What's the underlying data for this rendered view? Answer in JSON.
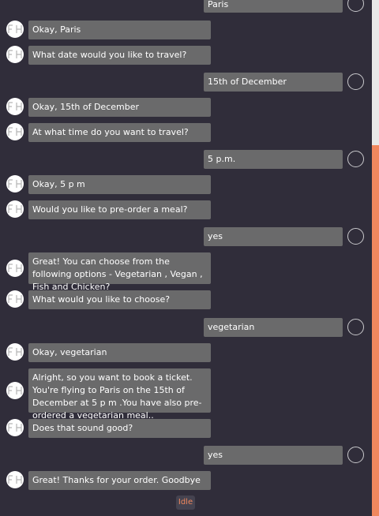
{
  "bot_initials": "FH",
  "messages": [
    {
      "from": "user",
      "text": "Paris"
    },
    {
      "from": "bot",
      "text": "Okay, Paris"
    },
    {
      "from": "bot",
      "text": "What date would you like to travel?"
    },
    {
      "from": "user",
      "text": "15th of December"
    },
    {
      "from": "bot",
      "text": "Okay, 15th of December"
    },
    {
      "from": "bot",
      "text": "At what time do you want to travel?"
    },
    {
      "from": "user",
      "text": "5 p.m."
    },
    {
      "from": "bot",
      "text": "Okay, 5 p m"
    },
    {
      "from": "bot",
      "text": "Would you like to pre-order a meal?"
    },
    {
      "from": "user",
      "text": "yes"
    },
    {
      "from": "bot",
      "text": "Great! You can choose from the following options - Vegetarian , Vegan , Fish and Chicken?"
    },
    {
      "from": "bot",
      "text": "What would you like to choose?"
    },
    {
      "from": "user",
      "text": "vegetarian"
    },
    {
      "from": "bot",
      "text": "Okay, vegetarian"
    },
    {
      "from": "bot",
      "text": "Alright, so you want to book a ticket. You're flying to Paris on the 15th of December at 5 p m .You have also pre-ordered a vegetarian meal.."
    },
    {
      "from": "bot",
      "text": "Does that sound good?"
    },
    {
      "from": "user",
      "text": "yes"
    },
    {
      "from": "bot",
      "text": "Great! Thanks for your order. Goodbye"
    }
  ],
  "status": "Idle",
  "colors": {
    "accent": "#f0875e",
    "background": "#302d3a",
    "bubble": "#6a6a6b"
  }
}
